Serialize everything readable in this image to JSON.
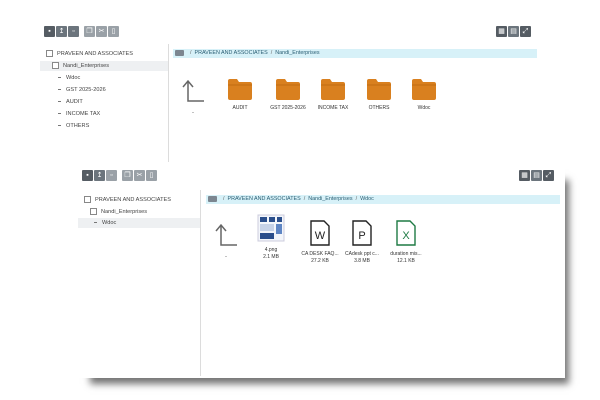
{
  "colors": {
    "folder": "#d9801f",
    "breadcrumb_bg": "#d7f1f8",
    "toolbar": "#6c757d",
    "excel": "#1e7a44"
  },
  "window1": {
    "toolbar_icons": [
      "folder-icon",
      "upload-icon",
      "trash-icon",
      "copy-icon",
      "cut-icon",
      "paste-icon"
    ],
    "view_icons": [
      "grid-view-icon",
      "list-view-icon",
      "fullscreen-icon"
    ],
    "tree": {
      "root": "PRAVEEN AND ASSOCIATES",
      "child": "Nandi_Enterprises",
      "items": [
        "Wdoc",
        "GST 2025-2026",
        "AUDIT",
        "INCOME TAX",
        "OTHERS"
      ]
    },
    "breadcrumb": [
      "PRAVEEN AND ASSOCIATES",
      "Nandi_Enterprises"
    ],
    "up_label": "..",
    "folders": [
      "AUDIT",
      "GST 2025-2026",
      "INCOME TAX",
      "OTHERS",
      "Wdoc"
    ]
  },
  "window2": {
    "toolbar_icons": [
      "folder-icon",
      "upload-icon",
      "trash-icon",
      "copy-icon",
      "cut-icon",
      "paste-icon"
    ],
    "view_icons": [
      "grid-view-icon",
      "list-view-icon",
      "fullscreen-icon"
    ],
    "tree": {
      "root": "PRAVEEN AND ASSOCIATES",
      "child": "Nandi_Enterprises",
      "items": [
        "Wdoc"
      ]
    },
    "breadcrumb": [
      "PRAVEEN AND ASSOCIATES",
      "Nandi_Enterprises",
      "Wdoc"
    ],
    "up_label": "..",
    "files": [
      {
        "name": "4.png",
        "size": "2.1 MB",
        "icon": "image-thumbnail"
      },
      {
        "name": "CA DESK FAQ...",
        "size": "27.2 KB",
        "icon": "word-doc-icon",
        "letter": "W"
      },
      {
        "name": "CAdesk ppt c...",
        "size": "3.8 MB",
        "icon": "powerpoint-icon",
        "letter": "P"
      },
      {
        "name": "duration mis...",
        "size": "12.1 KB",
        "icon": "excel-icon",
        "letter": "X"
      }
    ]
  }
}
